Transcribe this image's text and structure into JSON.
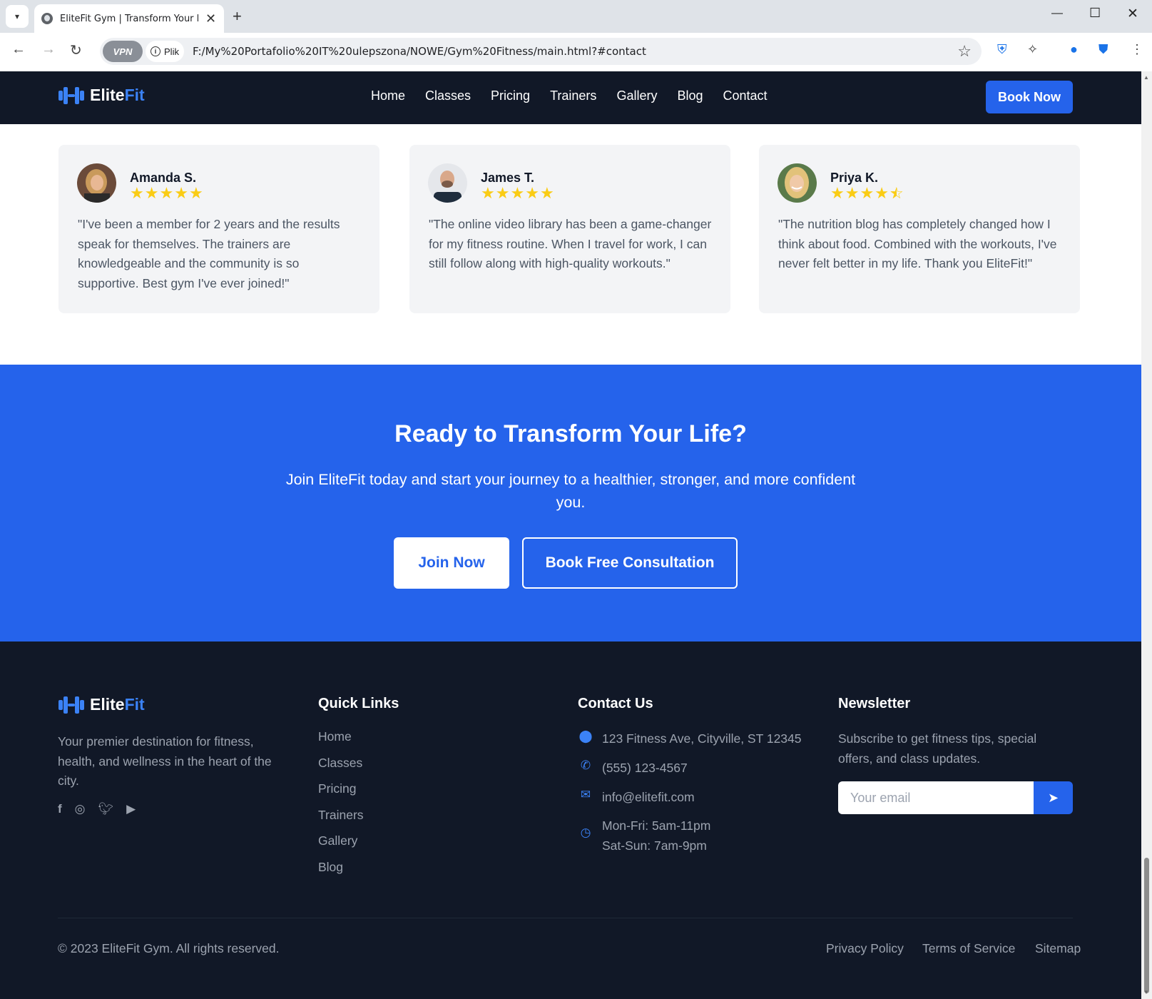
{
  "browser": {
    "tab_title": "EliteFit Gym | Transform Your Body",
    "new_tab_symbol": "+",
    "vpn_label": "VPN",
    "site_info_label": "Plik",
    "url": "F:/My%20Portafolio%20IT%20ulepszona/NOWE/Gym%20Fitness/main.html?#contact"
  },
  "nav": {
    "logo_main": "Elite",
    "logo_accent": "Fit",
    "links": [
      "Home",
      "Classes",
      "Pricing",
      "Trainers",
      "Gallery",
      "Blog",
      "Contact"
    ],
    "book_label": "Book Now"
  },
  "testimonials": [
    {
      "name": "Amanda S.",
      "rating": 5,
      "quote": "\"I've been a member for 2 years and the results speak for themselves. The trainers are knowledgeable and the community is so supportive. Best gym I've ever joined!\""
    },
    {
      "name": "James T.",
      "rating": 5,
      "quote": "\"The online video library has been a game-changer for my fitness routine. When I travel for work, I can still follow along with high-quality workouts.\""
    },
    {
      "name": "Priya K.",
      "rating": 4.5,
      "quote": "\"The nutrition blog has completely changed how I think about food. Combined with the workouts, I've never felt better in my life. Thank you EliteFit!\""
    }
  ],
  "cta": {
    "title": "Ready to Transform Your Life?",
    "text": "Join EliteFit today and start your journey to a healthier, stronger, and more confident you.",
    "join_label": "Join Now",
    "consult_label": "Book Free Consultation"
  },
  "footer": {
    "description": "Your premier destination for fitness, health, and wellness in the heart of the city.",
    "social_icons": [
      "facebook-icon",
      "instagram-icon",
      "twitter-icon",
      "youtube-icon"
    ],
    "quick_links_title": "Quick Links",
    "quick_links": [
      "Home",
      "Classes",
      "Pricing",
      "Trainers",
      "Gallery",
      "Blog"
    ],
    "contact_title": "Contact Us",
    "address": "123 Fitness Ave, Cityville, ST 12345",
    "phone": "(555) 123-4567",
    "email": "info@elitefit.com",
    "hours_weekday": "Mon-Fri: 5am-11pm",
    "hours_weekend": "Sat-Sun: 7am-9pm",
    "newsletter_title": "Newsletter",
    "newsletter_text": "Subscribe to get fitness tips, special offers, and class updates.",
    "email_placeholder": "Your email",
    "copyright": "© 2023 EliteFit Gym. All rights reserved.",
    "legal_links": [
      "Privacy Policy",
      "Terms of Service",
      "Sitemap"
    ]
  },
  "colors": {
    "brand": "#2563eb",
    "dark": "#111827",
    "star": "#facc15"
  }
}
